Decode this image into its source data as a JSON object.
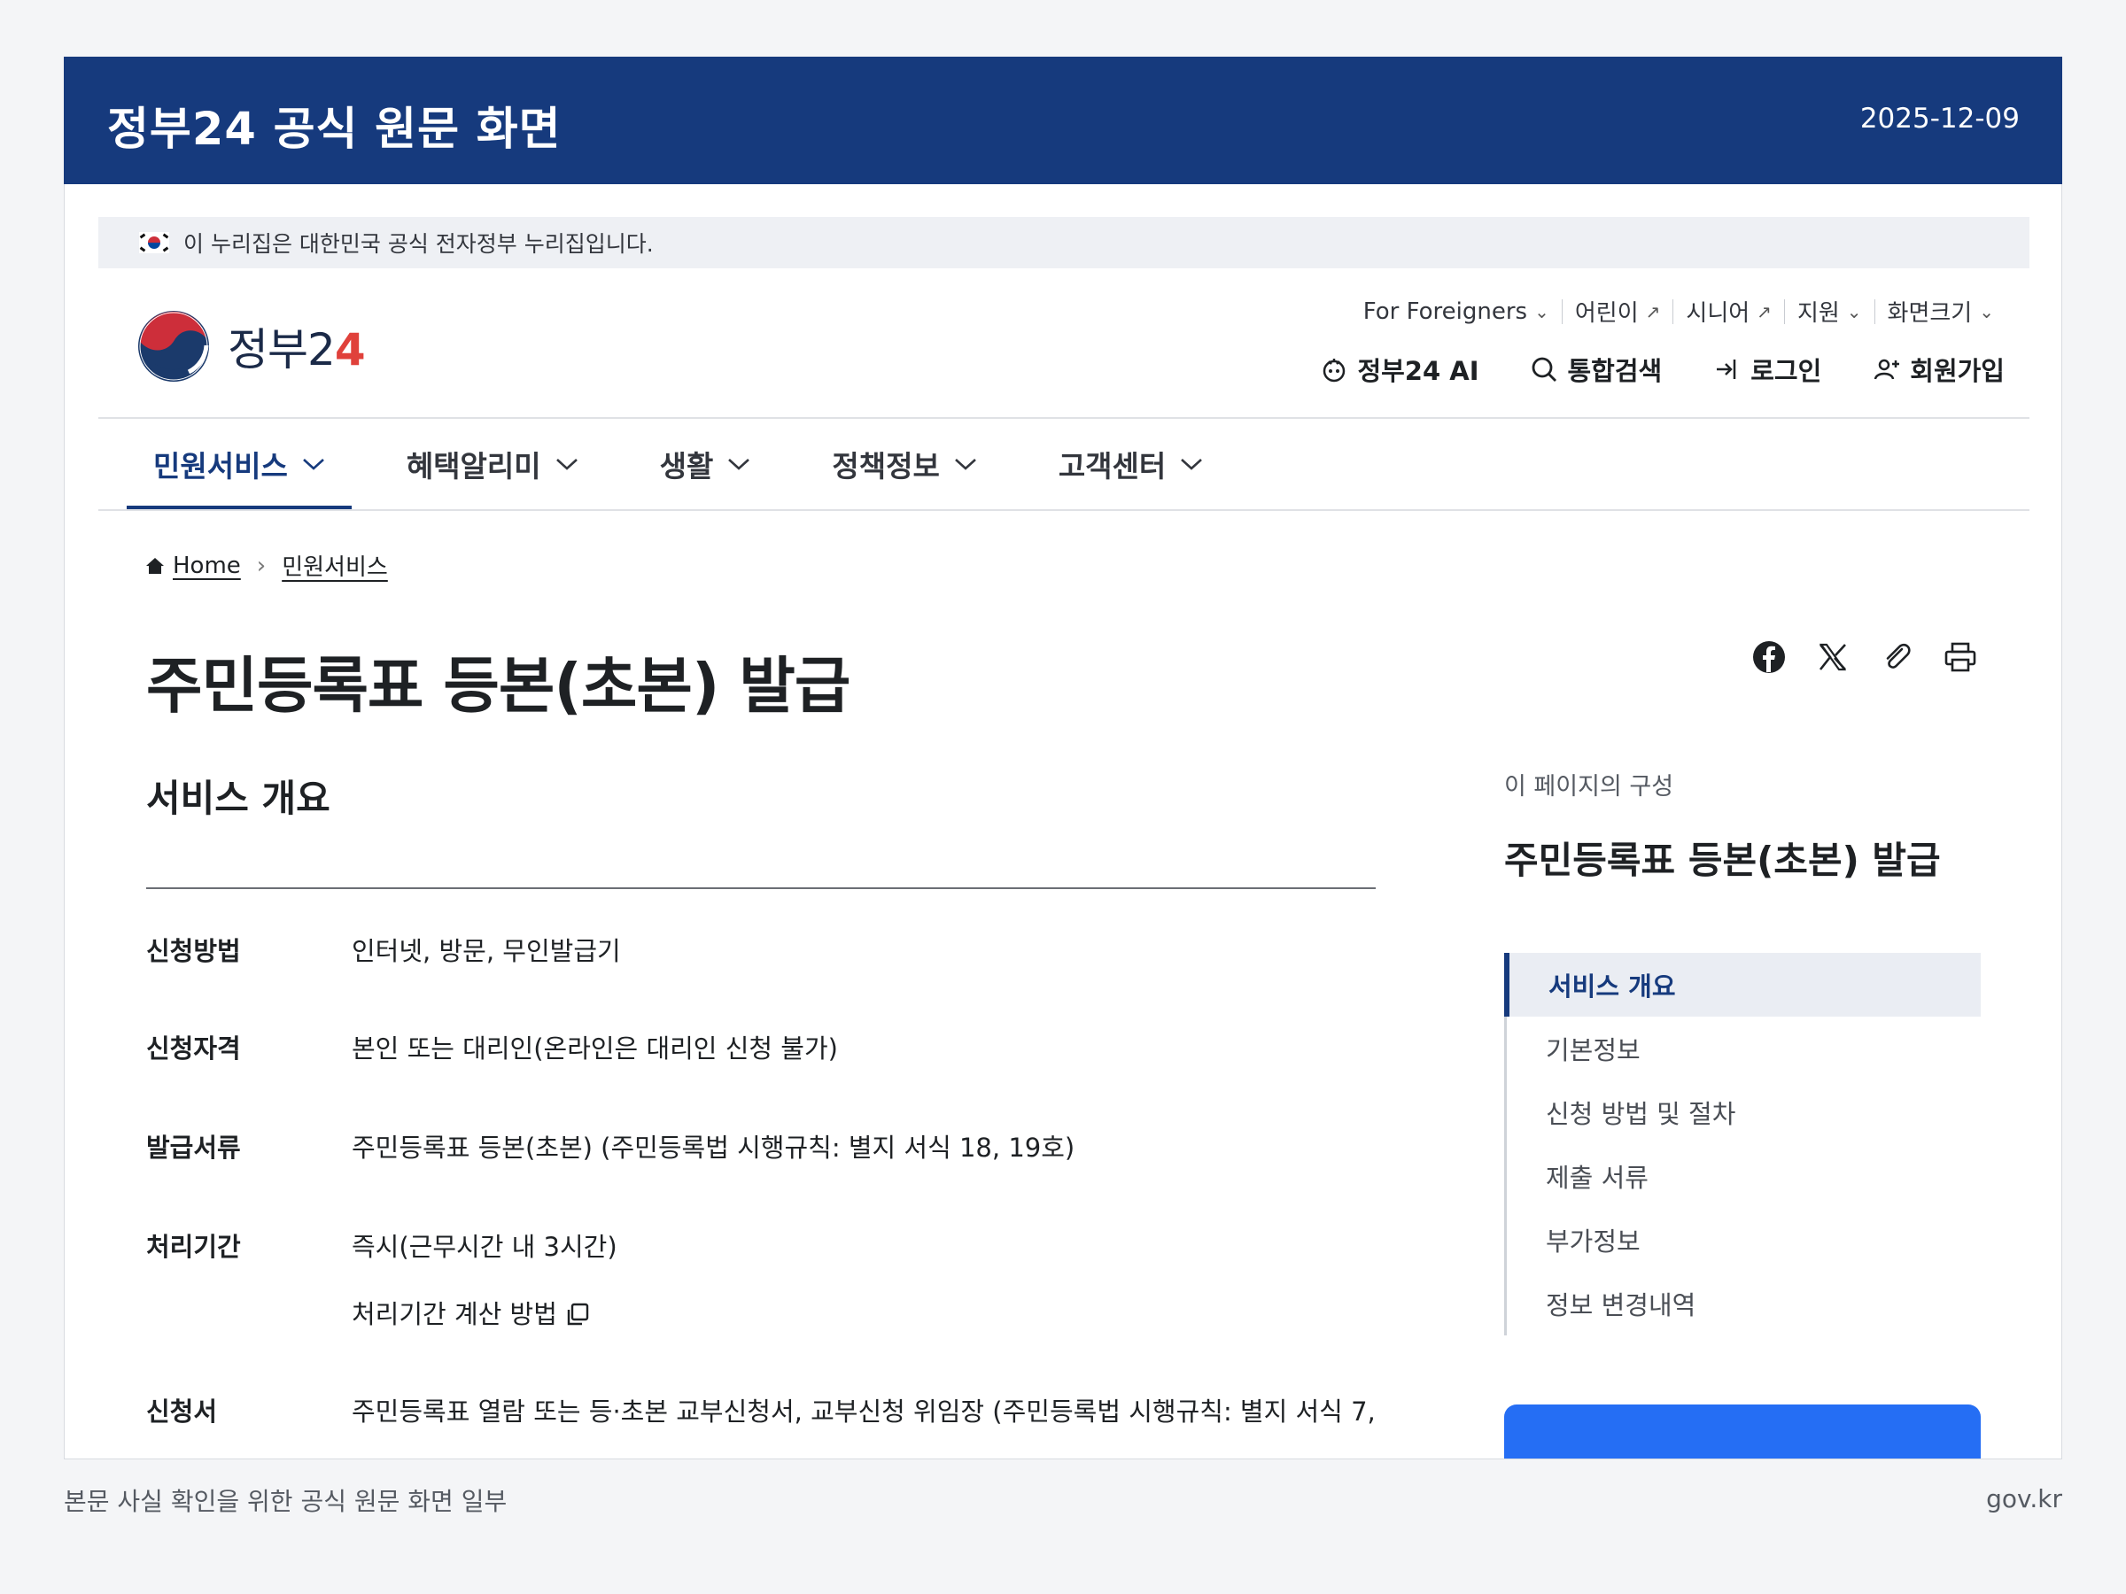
{
  "banner": {
    "title": "정부24 공식 원문 화면",
    "date": "2025-12-09"
  },
  "gov_notice": "이 누리집은 대한민국 공식 전자정부 누리집입니다.",
  "logo": {
    "text": "정부2",
    "num": "4"
  },
  "utility_links": [
    {
      "label": "For Foreigners",
      "icon": "chevron-down-icon"
    },
    {
      "label": "어린이",
      "icon": "external-link-icon"
    },
    {
      "label": "시니어",
      "icon": "external-link-icon"
    },
    {
      "label": "지원",
      "icon": "chevron-down-icon"
    },
    {
      "label": "화면크기",
      "icon": "chevron-down-icon"
    }
  ],
  "actions": [
    {
      "label": "정부24 AI",
      "icon": "ai-icon"
    },
    {
      "label": "통합검색",
      "icon": "search-icon"
    },
    {
      "label": "로그인",
      "icon": "login-icon"
    },
    {
      "label": "회원가입",
      "icon": "signup-icon"
    }
  ],
  "gnb": [
    "민원서비스",
    "혜택알리미",
    "생활",
    "정책정보",
    "고객센터"
  ],
  "breadcrumb": {
    "home": "Home",
    "current": "민원서비스"
  },
  "page_title": "주민등록표 등본(초본) 발급",
  "section_title": "서비스 개요",
  "info_rows": [
    {
      "key": "신청방법",
      "value": "인터넷, 방문, 무인발급기"
    },
    {
      "key": "신청자격",
      "value": "본인 또는 대리인(온라인은 대리인 신청 불가)"
    },
    {
      "key": "발급서류",
      "value": "주민등록표 등본(초본) (주민등록법 시행규칙: 별지 서식 18, 19호)"
    },
    {
      "key": "처리기간",
      "value": "즉시(근무시간 내 3시간)",
      "extra": "처리기간 계산 방법"
    },
    {
      "key": "신청서",
      "value": "주민등록표 열람 또는 등·초본 교부신청서, 교부신청 위임장 (주민등록법 시행규칙: 별지 서식 7,"
    }
  ],
  "toc": {
    "caption": "이 페이지의 구성",
    "title": "주민등록표 등본(초본) 발급",
    "items": [
      "서비스 개요",
      "기본정보",
      "신청 방법 및 절차",
      "제출 서류",
      "부가정보",
      "정보 변경내역"
    ]
  },
  "footer": {
    "left": "본문 사실 확인을 위한 공식 원문 화면 일부",
    "right": "gov.kr"
  },
  "colors": {
    "brand_navy": "#163a7d",
    "primary_blue": "#256ef4",
    "page_bg": "#f4f5f7"
  }
}
